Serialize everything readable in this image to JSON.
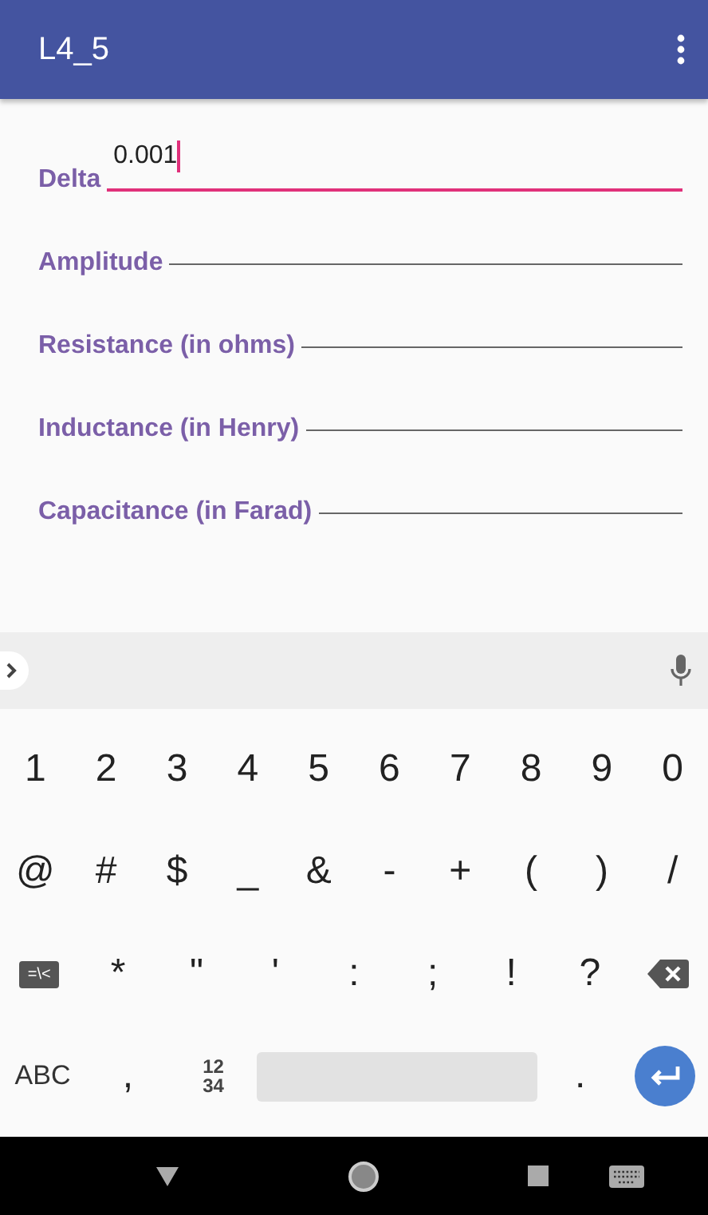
{
  "app_bar": {
    "title": "L4_5"
  },
  "fields": [
    {
      "label": "Delta",
      "value": "0.001",
      "focused": true
    },
    {
      "label": "Amplitude",
      "focused": false
    },
    {
      "label": "Resistance (in ohms)",
      "focused": false
    },
    {
      "label": "Inductance (in Henry)",
      "focused": false
    },
    {
      "label": "Capacitance (in Farad)",
      "focused": false
    }
  ],
  "keyboard": {
    "rows": [
      [
        {
          "kind": "char",
          "label": "1"
        },
        {
          "kind": "char",
          "label": "2"
        },
        {
          "kind": "char",
          "label": "3"
        },
        {
          "kind": "char",
          "label": "4"
        },
        {
          "kind": "char",
          "label": "5"
        },
        {
          "kind": "char",
          "label": "6"
        },
        {
          "kind": "char",
          "label": "7"
        },
        {
          "kind": "char",
          "label": "8"
        },
        {
          "kind": "char",
          "label": "9"
        },
        {
          "kind": "char",
          "label": "0"
        }
      ],
      [
        {
          "kind": "char",
          "label": "@"
        },
        {
          "kind": "char",
          "label": "#"
        },
        {
          "kind": "char",
          "label": "$"
        },
        {
          "kind": "char",
          "label": "_"
        },
        {
          "kind": "char",
          "label": "&"
        },
        {
          "kind": "char",
          "label": "-"
        },
        {
          "kind": "char",
          "label": "+"
        },
        {
          "kind": "char",
          "label": "("
        },
        {
          "kind": "char",
          "label": ")"
        },
        {
          "kind": "char",
          "label": "/"
        }
      ],
      [
        {
          "kind": "badge",
          "label": "=\\<"
        },
        {
          "kind": "char",
          "label": "*"
        },
        {
          "kind": "char",
          "label": "\""
        },
        {
          "kind": "char",
          "label": "'"
        },
        {
          "kind": "char",
          "label": ":"
        },
        {
          "kind": "char",
          "label": ";"
        },
        {
          "kind": "char",
          "label": "!"
        },
        {
          "kind": "char",
          "label": "?"
        },
        {
          "kind": "backspace"
        }
      ],
      [
        {
          "kind": "text",
          "label": "ABC"
        },
        {
          "kind": "char",
          "label": ","
        },
        {
          "kind": "stack",
          "lines": [
            "12",
            "34"
          ]
        },
        {
          "kind": "space"
        },
        {
          "kind": "char",
          "label": "."
        },
        {
          "kind": "enter"
        }
      ]
    ]
  }
}
